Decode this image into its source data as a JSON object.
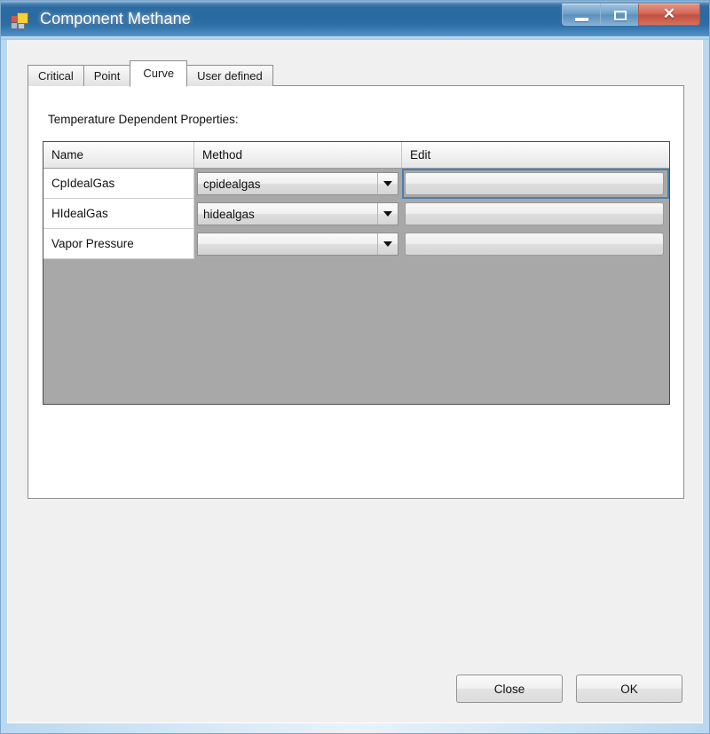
{
  "window": {
    "title": "Component Methane",
    "icon": "app-squares-icon",
    "controls": {
      "minimize": "minimize-icon",
      "maximize": "maximize-icon",
      "close": "✕"
    }
  },
  "tabs": [
    {
      "label": "Critical",
      "selected": false
    },
    {
      "label": "Point",
      "selected": false
    },
    {
      "label": "Curve",
      "selected": true
    },
    {
      "label": "User defined",
      "selected": false
    }
  ],
  "page": {
    "section_label": "Temperature Dependent Properties:"
  },
  "grid": {
    "columns": [
      "Name",
      "Method",
      "Edit"
    ],
    "rows": [
      {
        "name": "CpIdealGas",
        "method": "cpidealgas",
        "edit_label": "",
        "edit_selected": true
      },
      {
        "name": "HIdealGas",
        "method": "hidealgas",
        "edit_label": "",
        "edit_selected": false
      },
      {
        "name": "Vapor Pressure",
        "method": "",
        "edit_label": "",
        "edit_selected": false
      }
    ]
  },
  "buttons": {
    "close": "Close",
    "ok": "OK"
  },
  "colors": {
    "selection_border": "#4a7eb5",
    "grid_background": "#a8a8a8",
    "dialog_background": "#f0f0f0",
    "titlebar_blue": "#2a6aa2",
    "close_button_red": "#c2503f"
  }
}
